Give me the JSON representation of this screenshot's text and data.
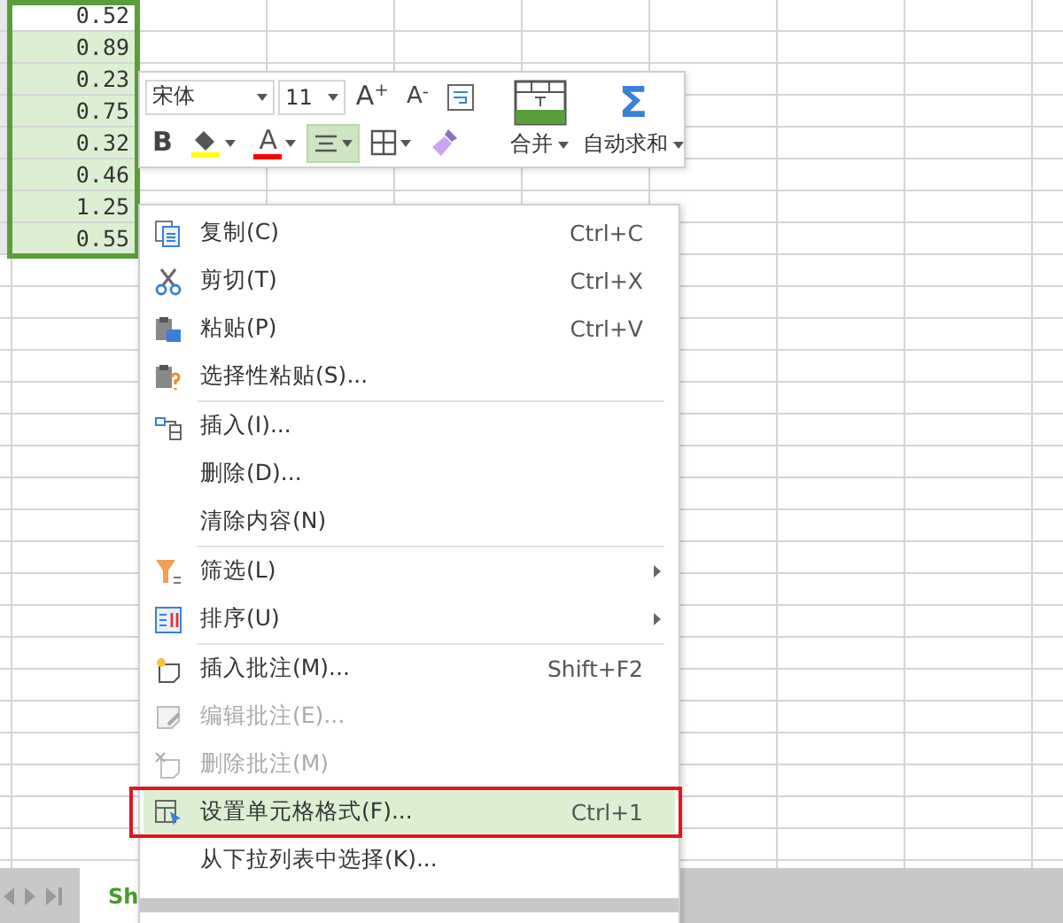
{
  "sheet": {
    "column_a": [
      {
        "value": "0.52",
        "active": true
      },
      {
        "value": "0.89",
        "active": false
      },
      {
        "value": "0.23",
        "active": false
      },
      {
        "value": "0.75",
        "active": false
      },
      {
        "value": "0.32",
        "active": false
      },
      {
        "value": "0.46",
        "active": false
      },
      {
        "value": "1.25",
        "active": false
      },
      {
        "value": "0.55",
        "active": false
      }
    ]
  },
  "sheet_tabs": [
    {
      "label": "Sh",
      "selected": true
    }
  ],
  "mini_toolbar": {
    "font": "宋体",
    "size": "11",
    "tools": [
      {
        "kind": "grow",
        "glyph": "A",
        "mark": "+"
      },
      {
        "kind": "shrink",
        "glyph": "A",
        "mark": "-"
      },
      {
        "kind": "wrap"
      }
    ],
    "format_tools": [
      {
        "kind": "bold",
        "glyph": "B",
        "selected": false
      },
      {
        "kind": "fill",
        "color": "#ffff00",
        "selected": false
      },
      {
        "kind": "fontcolor",
        "glyph": "A",
        "color": "#ff0000",
        "selected": false
      },
      {
        "kind": "align",
        "selected": true
      },
      {
        "kind": "border",
        "selected": false
      },
      {
        "kind": "brush",
        "selected": false
      }
    ],
    "big_tools": [
      {
        "kind": "merge",
        "label": "合并"
      },
      {
        "kind": "sum",
        "glyph": "Σ",
        "label": "自动求和"
      }
    ]
  },
  "context_menu": [
    {
      "kind": "copy",
      "label": "复制(C)",
      "shortcut": "Ctrl+C",
      "disabled": false,
      "selected": false,
      "outlined": false
    },
    {
      "kind": "cut",
      "label": "剪切(T)",
      "shortcut": "Ctrl+X",
      "disabled": false,
      "selected": false,
      "outlined": false
    },
    {
      "kind": "paste",
      "label": "粘贴(P)",
      "shortcut": "Ctrl+V",
      "disabled": false,
      "selected": false,
      "outlined": false
    },
    {
      "kind": "paste-special",
      "label": "选择性粘贴(S)...",
      "disabled": false,
      "selected": false,
      "outlined": false,
      "separator_after": true
    },
    {
      "kind": "insert",
      "label": "插入(I)...",
      "disabled": false,
      "selected": false,
      "outlined": false
    },
    {
      "label": "删除(D)...",
      "disabled": false,
      "selected": false,
      "outlined": false
    },
    {
      "label": "清除内容(N)",
      "disabled": false,
      "selected": false,
      "outlined": false,
      "separator_after": true
    },
    {
      "kind": "filter",
      "label": "筛选(L)",
      "submenu": true,
      "disabled": false,
      "selected": false,
      "outlined": false
    },
    {
      "kind": "sort",
      "label": "排序(U)",
      "submenu": true,
      "disabled": false,
      "selected": false,
      "outlined": false,
      "separator_after": true
    },
    {
      "kind": "comment-new",
      "label": "插入批注(M)...",
      "shortcut": "Shift+F2",
      "disabled": false,
      "selected": false,
      "outlined": false
    },
    {
      "kind": "comment-edit",
      "label": "编辑批注(E)...",
      "disabled": true,
      "selected": false,
      "outlined": false
    },
    {
      "kind": "comment-delete",
      "label": "删除批注(M)",
      "disabled": true,
      "selected": false,
      "outlined": false
    },
    {
      "kind": "format",
      "label": "设置单元格格式(F)...",
      "shortcut": "Ctrl+1",
      "disabled": false,
      "selected": true,
      "outlined": true
    },
    {
      "label": "从下拉列表中选择(K)...",
      "disabled": false,
      "selected": false,
      "outlined": false
    }
  ]
}
